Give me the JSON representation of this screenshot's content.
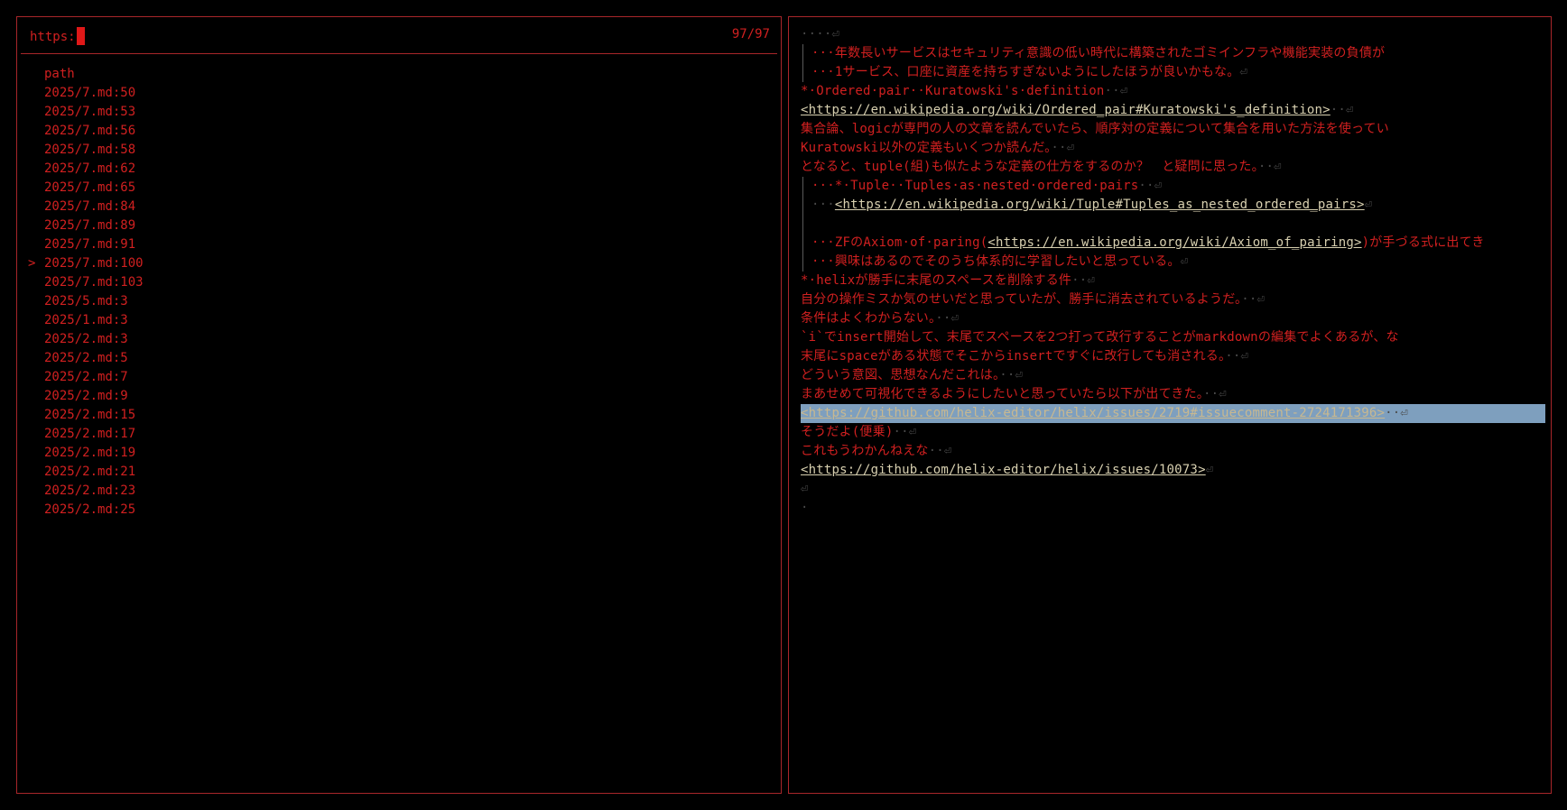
{
  "picker": {
    "query": "https:",
    "count": "97/97",
    "header": "path",
    "selected_marker": ">",
    "items": [
      "2025/7.md:50",
      "2025/7.md:53",
      "2025/7.md:56",
      "2025/7.md:58",
      "2025/7.md:62",
      "2025/7.md:65",
      "2025/7.md:84",
      "2025/7.md:89",
      "2025/7.md:91",
      "2025/7.md:100",
      "2025/7.md:103",
      "2025/5.md:3",
      "2025/1.md:3",
      "2025/2.md:3",
      "2025/2.md:5",
      "2025/2.md:7",
      "2025/2.md:9",
      "2025/2.md:15",
      "2025/2.md:17",
      "2025/2.md:19",
      "2025/2.md:21",
      "2025/2.md:23",
      "2025/2.md:25"
    ],
    "selected_index": 9
  },
  "preview": {
    "l1": "····⏎",
    "l2": "···年数長いサービスはセキュリティ意識の低い時代に構築されたゴミインフラや機能実装の負債が",
    "l3": "···1サービス、口座に資産を持ちすぎないようにしたほうが良いかもな。",
    "l4a": "*·Ordered·pair··Kuratowski's·definition",
    "l5link": "<https://en.wikipedia.org/wiki/Ordered_pair#Kuratowski's_definition>",
    "l6": "集合論、logicが専門の人の文章を読んでいたら、順序対の定義について集合を用いた方法を使ってい",
    "l7": "Kuratowski以外の定義もいくつか読んだ。",
    "l8": "となると、tuple(組)も似たような定義の仕方をするのか？　と疑問に思った。",
    "l9": "···*·Tuple··Tuples·as·nested·ordered·pairs",
    "l10pre": "···",
    "l10link": "<https://en.wikipedia.org/wiki/Tuple#Tuples_as_nested_ordered_pairs>",
    "l12pre": "···ZFのAxiom·of·paring(",
    "l12link": "<https://en.wikipedia.org/wiki/Axiom_of_pairing>",
    "l12post": ")が手づる式に出てき",
    "l13": "···興味はあるのでそのうち体系的に学習したいと思っている。",
    "l14": "*·helixが勝手に末尾のスペースを削除する件",
    "l15": "自分の操作ミスか気のせいだと思っていたが、勝手に消去されているようだ。",
    "l16": "条件はよくわからない。",
    "l17": "`i`でinsert開始して、末尾でスペースを2つ打って改行することがmarkdownの編集でよくあるが、な",
    "l18": "末尾にspaceがある状態でそこからinsertですぐに改行しても消される。",
    "l19": "どういう意図、思想なんだこれは。",
    "l20": "まあせめて可視化できるようにしたいと思っていたら以下が出てきた。",
    "l21link": "<https://github.com/helix-editor/helix/issues/2719#issuecomment-2724171396>",
    "l22": "そうだよ(便乗)",
    "l23": "これもうわかんねえな",
    "l24link": "<https://github.com/helix-editor/helix/issues/10073>",
    "eol": "⏎",
    "sp2": "··",
    "last": "·"
  },
  "colors": {
    "border": "#a8262a",
    "text": "#d12020",
    "link": "#d8d0b0",
    "selection": "#7e9fbe"
  }
}
